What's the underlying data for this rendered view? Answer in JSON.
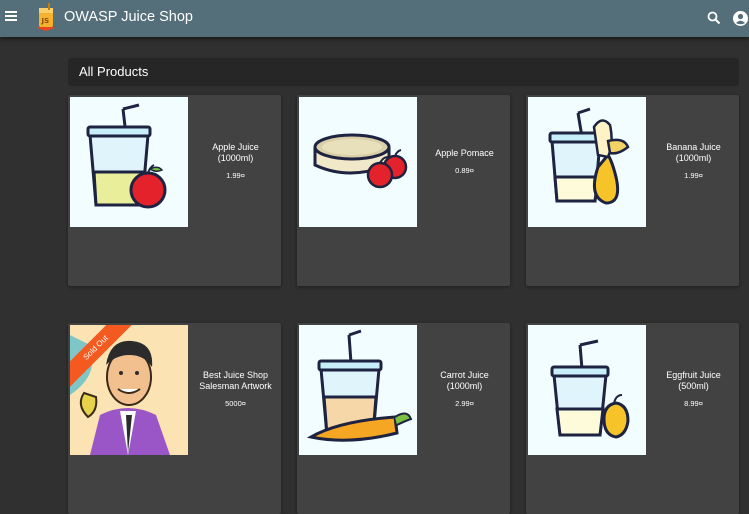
{
  "app": {
    "title": "OWASP Juice Shop"
  },
  "toolbar": {
    "menu_icon": "menu-icon",
    "search_icon": "search-icon",
    "account_icon": "account-icon"
  },
  "products": {
    "heading": "All Products",
    "items": [
      {
        "name": "Apple Juice (1000ml)",
        "price": "1.99¤",
        "image": "apple-juice-image"
      },
      {
        "name": "Apple Pomace",
        "price": "0.89¤",
        "image": "apple-pomace-image"
      },
      {
        "name": "Banana Juice (1000ml)",
        "price": "1.99¤",
        "image": "banana-juice-image"
      },
      {
        "name": "Best Juice Shop Salesman Artwork",
        "price": "5000¤",
        "image": "salesman-artwork-image",
        "badge": "Sold Out"
      },
      {
        "name": "Carrot Juice (1000ml)",
        "price": "2.99¤",
        "image": "carrot-juice-image"
      },
      {
        "name": "Eggfruit Juice (500ml)",
        "price": "8.99¤",
        "image": "eggfruit-juice-image"
      }
    ]
  },
  "colors": {
    "toolbar": "#546e7a",
    "background": "#303030",
    "card": "#424242",
    "sold_out": "#f45a1f"
  }
}
